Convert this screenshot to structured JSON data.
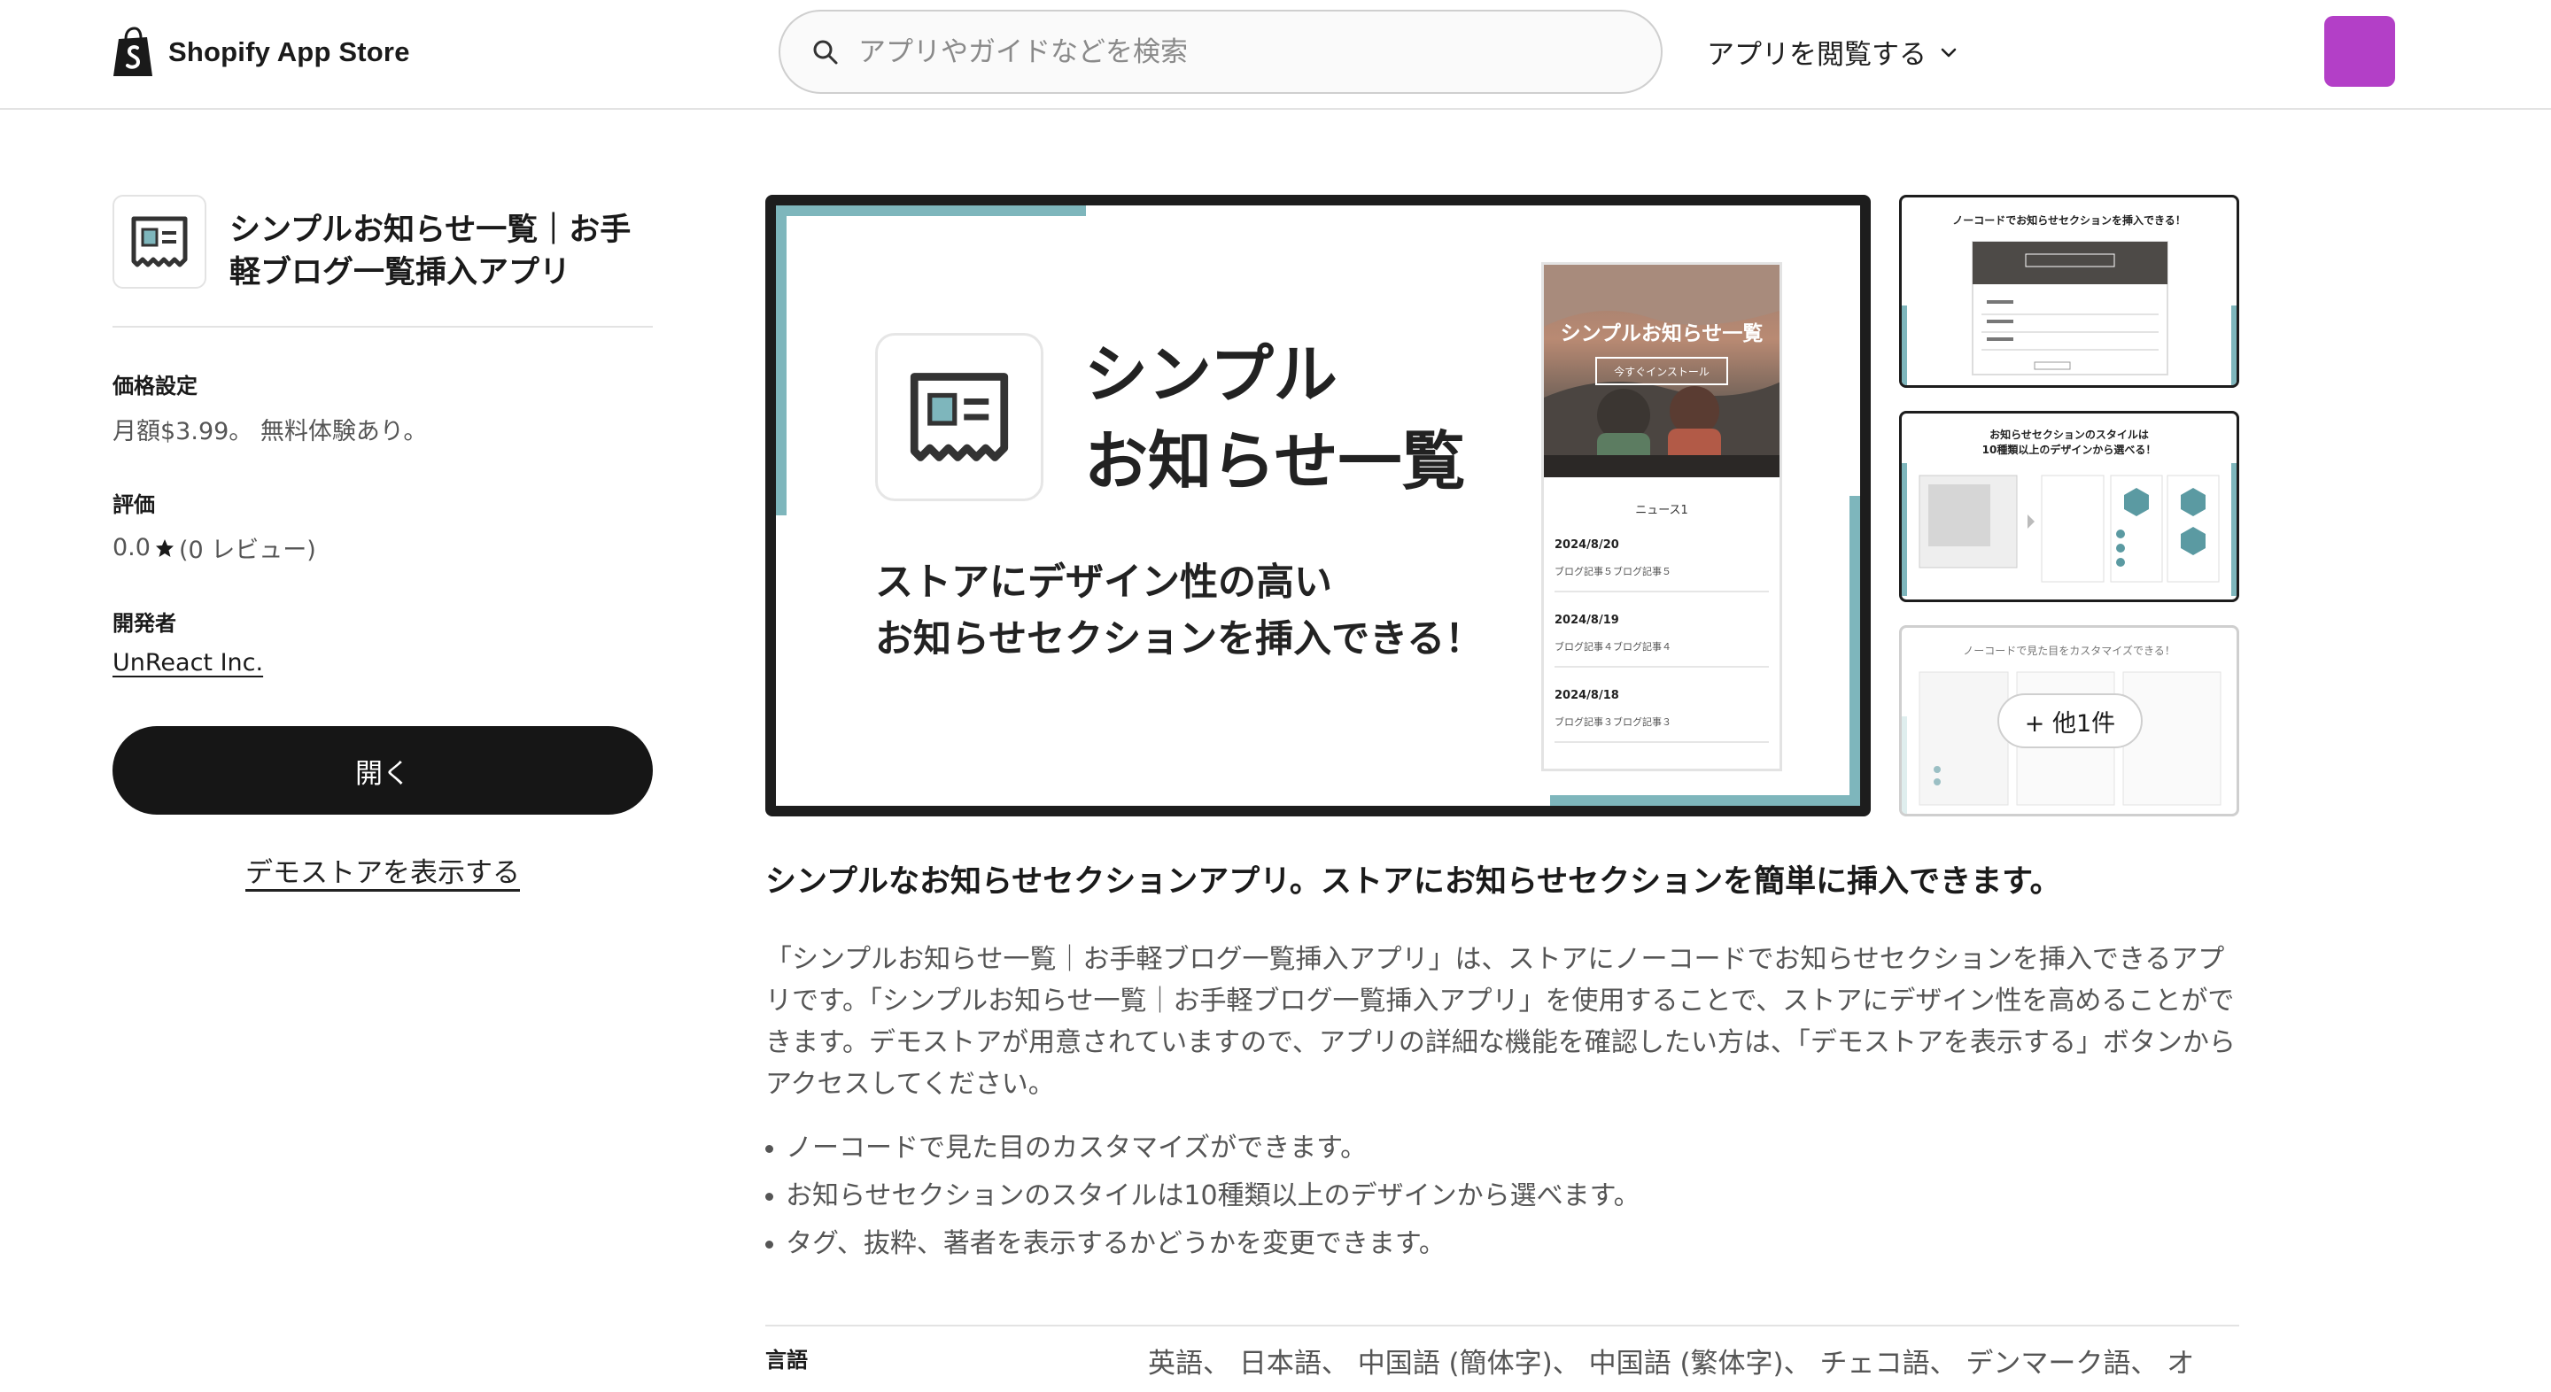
{
  "header": {
    "brand": "Shopify App Store",
    "search_placeholder": "アプリやガイドなどを検索",
    "browse_label": "アプリを閲覧する"
  },
  "app": {
    "title": "シンプルお知らせ一覧｜お手軽ブログ一覧挿入アプリ",
    "pricing_label": "価格設定",
    "pricing_value": "月額$3.99。 無料体験あり。",
    "rating_label": "評価",
    "rating_value": "0.0",
    "rating_count": "(0 レビュー)",
    "developer_label": "開発者",
    "developer_name": "UnReact Inc.",
    "open_button": "開く",
    "demo_link": "デモストアを表示する"
  },
  "gallery": {
    "main": {
      "title_line1": "シンプル",
      "title_line2": "お知らせ一覧",
      "sub_line1": "ストアにデザイン性の高い",
      "sub_line2": "お知らせセクションを挿入できる！",
      "phone_title": "シンプルお知らせ一覧",
      "phone_button": "今すぐインストール",
      "phone_news": "ニュース1",
      "items": [
        {
          "date": "2024/8/20",
          "text": "ブログ記事５ブログ記事５"
        },
        {
          "date": "2024/8/19",
          "text": "ブログ記事４ブログ記事４"
        },
        {
          "date": "2024/8/18",
          "text": "ブログ記事３ブログ記事３"
        }
      ]
    },
    "thumb1_caption": "ノーコードでお知らせセクションを挿入できる！",
    "thumb2_caption_line1": "お知らせセクションのスタイルは",
    "thumb2_caption_line2": "10種類以上のデザインから選べる！",
    "thumb3_caption": "ノーコードで見た目をカスタマイズできる！",
    "more_label": "+ 他1件"
  },
  "description": {
    "headline": "シンプルなお知らせセクションアプリ。ストアにお知らせセクションを簡単に挿入できます。",
    "body": "「シンプルお知らせ一覧｜お手軽ブログ一覧挿入アプリ」は、ストアにノーコードでお知らせセクションを挿入できるアプリです。「シンプルお知らせ一覧｜お手軽ブログ一覧挿入アプリ」を使用することで、ストアにデザイン性を高めることができます。デモストアが用意されていますので、アプリの詳細な機能を確認したい方は、「デモストアを表示する」ボタンからアクセスしてください。",
    "features": [
      "ノーコードで見た目のカスタマイズができます。",
      "お知らせセクションのスタイルは10種類以上のデザインから選べます。",
      "タグ、抜粋、著者を表示するかどうかを変更できます。"
    ]
  },
  "languages": {
    "label": "言語",
    "value": "英語、 日本語、 中国語 (簡体字)、 中国語 (繁体字)、 チェコ語、 デンマーク語、 オ"
  },
  "colors": {
    "accent_teal": "#7eb6bc",
    "avatar": "#b33fc7",
    "button_dark": "#161616"
  }
}
